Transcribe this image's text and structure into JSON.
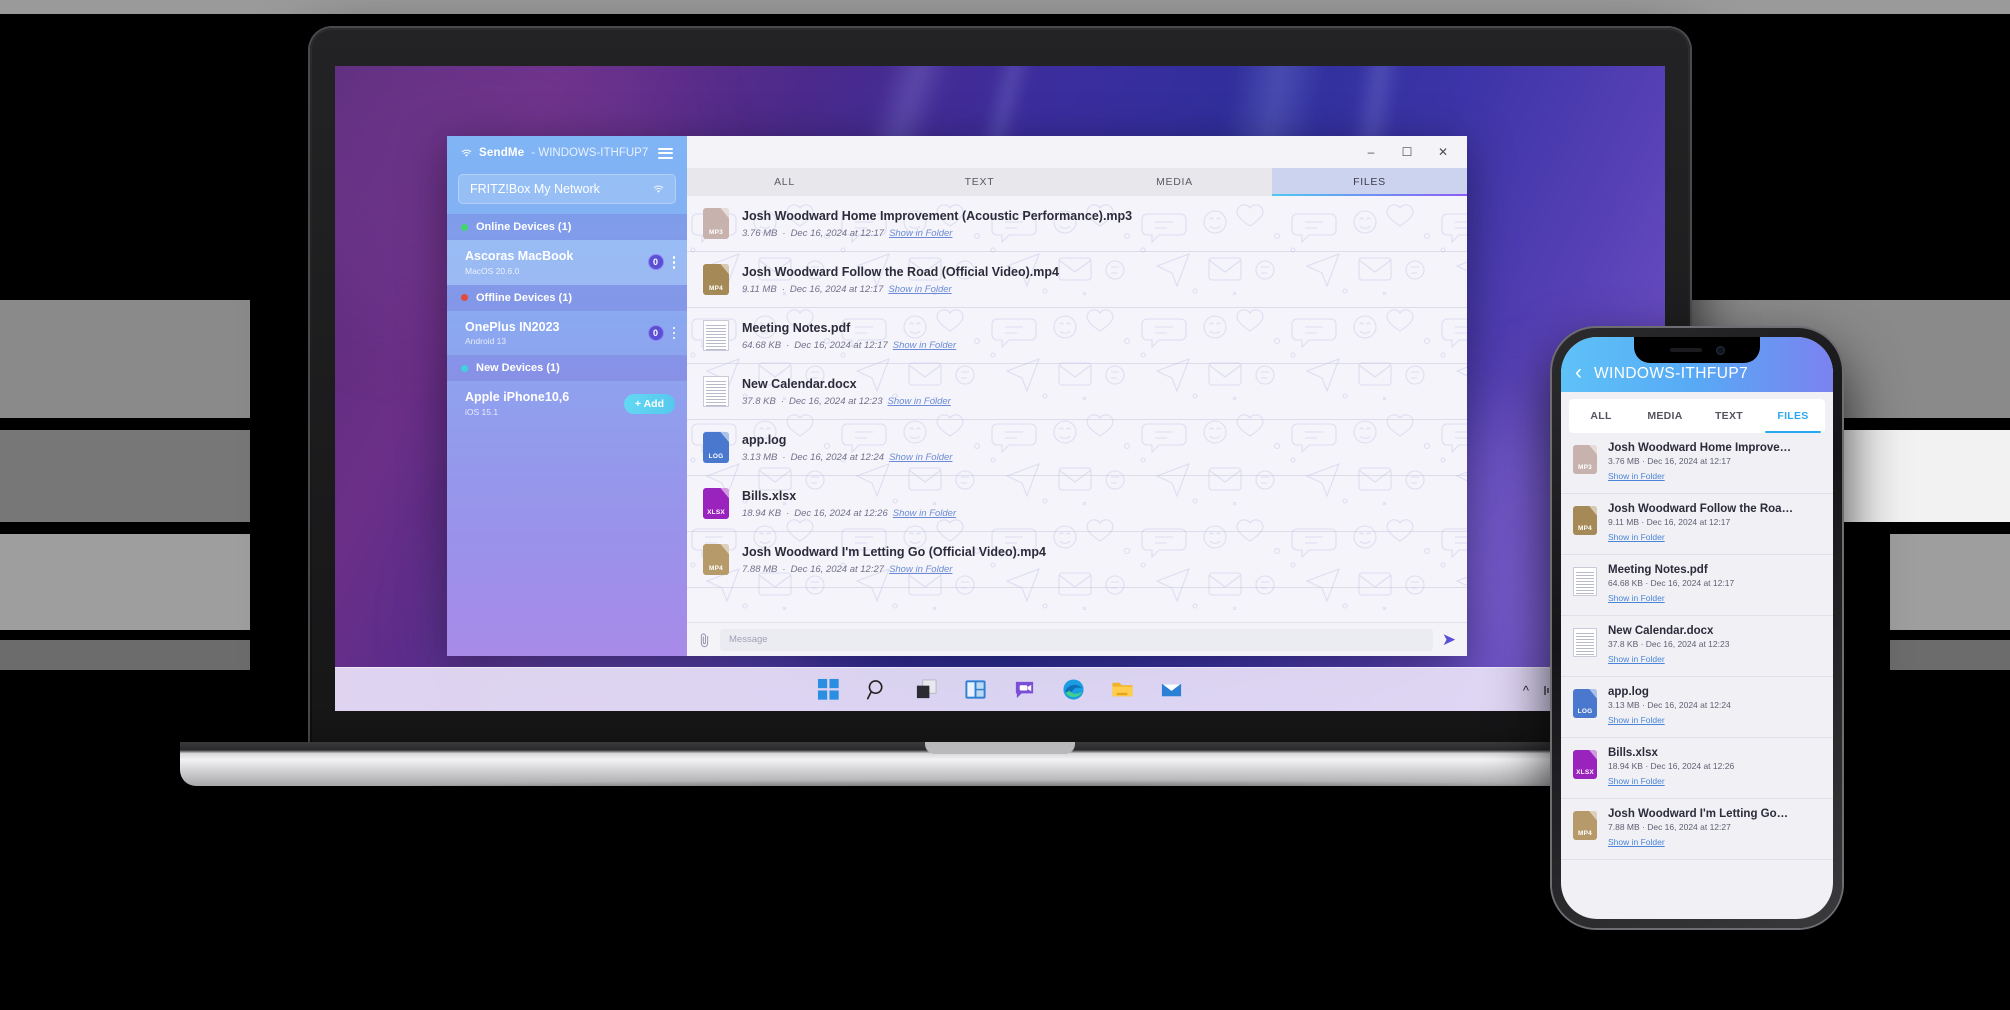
{
  "app": {
    "sidebar": {
      "brand": "SendMe",
      "separator": "-",
      "hostname": "WINDOWS-ITHFUP7",
      "network_name": "FRITZ!Box My Network",
      "menu_icon": "hamburger-menu-icon",
      "wifi_icon": "wifi-icon",
      "groups": [
        {
          "label": "Online Devices (1)",
          "dot_color": "#43d66a",
          "devices": [
            {
              "name": "Ascoras MacBook",
              "os": "MacOS 20.6.0",
              "badge": "0",
              "selected": true,
              "action": "kebab"
            }
          ]
        },
        {
          "label": "Offline Devices (1)",
          "dot_color": "#e24a3c",
          "devices": [
            {
              "name": "OnePlus IN2023",
              "os": "Android 13",
              "badge": "0",
              "selected": false,
              "action": "kebab"
            }
          ]
        },
        {
          "label": "New Devices (1)",
          "dot_color": "#3fd3e0",
          "devices": [
            {
              "name": "Apple iPhone10,6",
              "os": "iOS 15.1",
              "add_label": "+ Add",
              "selected": false,
              "action": "add"
            }
          ]
        }
      ]
    },
    "window_controls": {
      "minimize": "–",
      "maximize": "☐",
      "close": "✕"
    },
    "tabs": [
      {
        "label": "ALL",
        "active": false
      },
      {
        "label": "TEXT",
        "active": false
      },
      {
        "label": "MEDIA",
        "active": false
      },
      {
        "label": "FILES",
        "active": true
      }
    ],
    "files": [
      {
        "name": "Josh Woodward Home Improvement (Acoustic Performance).mp3",
        "size": "3.76 MB",
        "dot": "·",
        "date": "Dec 16, 2024 at 12:17",
        "link": "Show in Folder",
        "icon": "mp3-file-icon",
        "icon_kind": "tag",
        "tag": "MP3",
        "color": "#c8b2ae"
      },
      {
        "name": "Josh Woodward Follow the Road (Official Video).mp4",
        "size": "9.11 MB",
        "dot": "·",
        "date": "Dec 16, 2024 at 12:17",
        "link": "Show in Folder",
        "icon": "mp4-file-icon",
        "icon_kind": "tag",
        "tag": "MP4",
        "color": "#a58a57"
      },
      {
        "name": "Meeting Notes.pdf",
        "size": "64.68 KB",
        "dot": "·",
        "date": "Dec 16, 2024 at 12:17",
        "link": "Show in Folder",
        "icon": "pdf-file-icon",
        "icon_kind": "sheet",
        "tag": "",
        "color": "#ffffff"
      },
      {
        "name": "New Calendar.docx",
        "size": "37.8 KB",
        "dot": "·",
        "date": "Dec 16, 2024 at 12:23",
        "link": "Show in Folder",
        "icon": "docx-file-icon",
        "icon_kind": "sheet",
        "tag": "",
        "color": "#ffffff"
      },
      {
        "name": "app.log",
        "size": "3.13 MB",
        "dot": "·",
        "date": "Dec 16, 2024 at 12:24",
        "link": "Show in Folder",
        "icon": "log-file-icon",
        "icon_kind": "tag",
        "tag": "LOG",
        "color": "#4a78cf"
      },
      {
        "name": "Bills.xlsx",
        "size": "18.94 KB",
        "dot": "·",
        "date": "Dec 16, 2024 at 12:26",
        "link": "Show in Folder",
        "icon": "xlsx-file-icon",
        "icon_kind": "tag",
        "tag": "XLSX",
        "color": "#9b23bd"
      },
      {
        "name": "Josh Woodward I'm Letting Go (Official Video).mp4",
        "size": "7.88 MB",
        "dot": "·",
        "date": "Dec 16, 2024 at 12:27",
        "link": "Show in Folder",
        "icon": "mp4-file-icon",
        "icon_kind": "tag",
        "tag": "MP4",
        "color": "#b79a6a"
      }
    ],
    "composer": {
      "attach_icon": "paperclip-icon",
      "placeholder": "Message",
      "send_icon": "send-icon"
    }
  },
  "phone": {
    "back_icon": "chevron-left-icon",
    "title": "WINDOWS-ITHFUP7",
    "tabs": [
      {
        "label": "ALL",
        "active": false
      },
      {
        "label": "MEDIA",
        "active": false
      },
      {
        "label": "TEXT",
        "active": false
      },
      {
        "label": "FILES",
        "active": true
      }
    ],
    "files": [
      {
        "name": "Josh Woodward Home Improve…",
        "meta": "3.76 MB · Dec 16, 2024 at 12:17",
        "link": "Show in Folder",
        "icon": "mp3-file-icon",
        "icon_kind": "tag",
        "tag": "MP3",
        "color": "#c8b2ae"
      },
      {
        "name": "Josh Woodward Follow the Roa…",
        "meta": "9.11 MB · Dec 16, 2024 at 12:17",
        "link": "Show in Folder",
        "icon": "mp4-file-icon",
        "icon_kind": "tag",
        "tag": "MP4",
        "color": "#a58a57"
      },
      {
        "name": "Meeting Notes.pdf",
        "meta": "64.68 KB · Dec 16, 2024 at 12:17",
        "link": "Show in Folder",
        "icon": "pdf-file-icon",
        "icon_kind": "sheet",
        "tag": "",
        "color": "#ffffff"
      },
      {
        "name": "New Calendar.docx",
        "meta": "37.8 KB · Dec 16, 2024 at 12:23",
        "link": "Show in Folder",
        "icon": "docx-file-icon",
        "icon_kind": "sheet",
        "tag": "",
        "color": "#ffffff"
      },
      {
        "name": "app.log",
        "meta": "3.13 MB · Dec 16, 2024 at 12:24",
        "link": "Show in Folder",
        "icon": "log-file-icon",
        "icon_kind": "tag",
        "tag": "LOG",
        "color": "#4a78cf"
      },
      {
        "name": "Bills.xlsx",
        "meta": "18.94 KB · Dec 16, 2024 at 12:26",
        "link": "Show in Folder",
        "icon": "xlsx-file-icon",
        "icon_kind": "tag",
        "tag": "XLSX",
        "color": "#9b23bd"
      },
      {
        "name": "Josh Woodward I'm Letting Go…",
        "meta": "7.88 MB · Dec 16, 2024 at 12:27",
        "link": "Show in Folder",
        "icon": "mp4-file-icon",
        "icon_kind": "tag",
        "tag": "MP4",
        "color": "#b79a6a"
      }
    ]
  },
  "taskbar": {
    "items": [
      {
        "icon": "windows-start-icon"
      },
      {
        "icon": "search-icon"
      },
      {
        "icon": "task-view-icon"
      },
      {
        "icon": "widgets-icon"
      },
      {
        "icon": "chat-teams-icon"
      },
      {
        "icon": "edge-browser-icon"
      },
      {
        "icon": "file-explorer-icon"
      },
      {
        "icon": "mail-icon"
      }
    ],
    "tray": [
      {
        "icon": "chevron-up-icon"
      },
      {
        "icon": "network-activity-icon"
      },
      {
        "icon": "wifi-icon"
      },
      {
        "icon": "volume-icon"
      },
      {
        "icon": "battery-icon"
      }
    ]
  },
  "colors": {
    "accent_purple": "#5b4fd6",
    "accent_blue": "#4fc8f0",
    "tab_active_bg": "#ccd3ee",
    "sidebar_top": "#7fb4f5",
    "sidebar_bottom": "#a88ae9"
  }
}
